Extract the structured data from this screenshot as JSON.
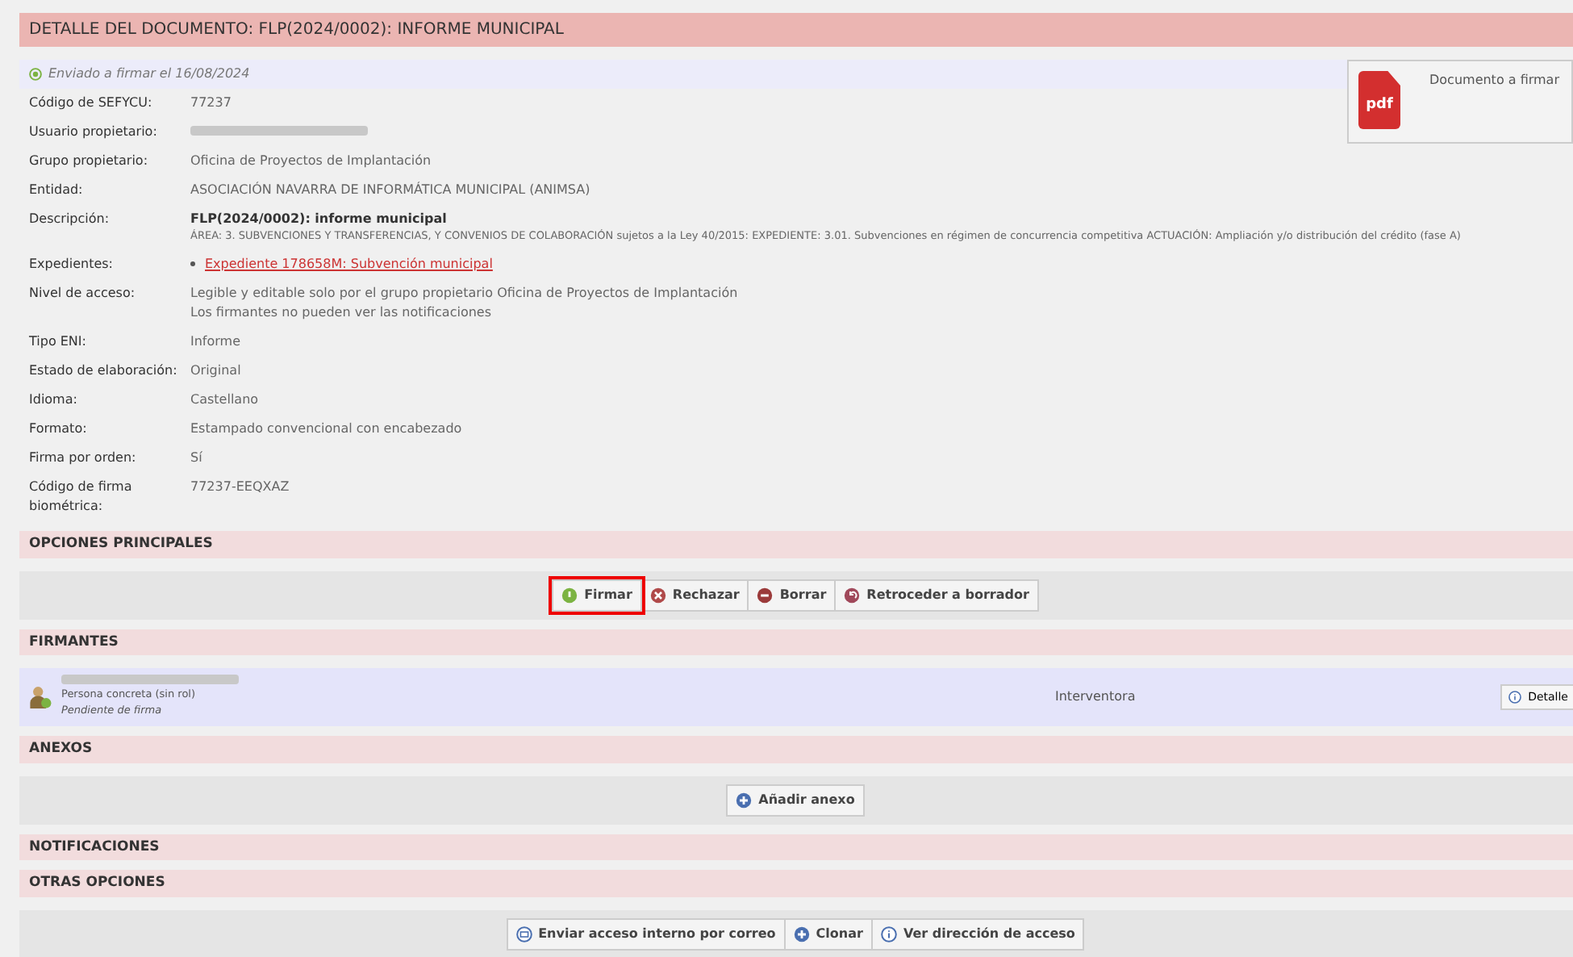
{
  "title": "DETALLE DEL DOCUMENTO: FLP(2024/0002): INFORME MUNICIPAL",
  "status": "Enviado a firmar el 16/08/2024",
  "document_card": {
    "label": "Documento a firmar",
    "file_type": "pdf"
  },
  "fields": [
    {
      "kind": "text",
      "label": "Código de SEFYCU:",
      "lines": [
        "77237"
      ]
    },
    {
      "kind": "redacted",
      "label": "Usuario propietario:"
    },
    {
      "kind": "text",
      "label": "Grupo propietario:",
      "lines": [
        "Oficina de Proyectos de Implantación"
      ]
    },
    {
      "kind": "text",
      "label": "Entidad:",
      "lines": [
        "ASOCIACIÓN NAVARRA DE INFORMÁTICA MUNICIPAL (ANIMSA)"
      ]
    },
    {
      "kind": "description",
      "label": "Descripción:",
      "lines": [
        "FLP(2024/0002): informe municipal",
        "ÁREA: 3. SUBVENCIONES Y TRANSFERENCIAS, Y CONVENIOS DE COLABORACIÓN sujetos a la Ley 40/2015: EXPEDIENTE: 3.01. Subvenciones en régimen de concurrencia competitiva ACTUACIÓN: Ampliación y/o distribución del crédito (fase A)"
      ]
    },
    {
      "kind": "link",
      "label": "Expedientes:",
      "lines": [
        "Expediente 178658M: Subvención municipal"
      ]
    },
    {
      "kind": "text",
      "label": "Nivel de acceso:",
      "lines": [
        "Legible y editable solo por el grupo propietario Oficina de Proyectos de Implantación",
        "Los firmantes no pueden ver las notificaciones"
      ]
    },
    {
      "kind": "text",
      "label": "Tipo ENI:",
      "lines": [
        "Informe"
      ]
    },
    {
      "kind": "text",
      "label": "Estado de elaboración:",
      "lines": [
        "Original"
      ]
    },
    {
      "kind": "text",
      "label": "Idioma:",
      "lines": [
        "Castellano"
      ]
    },
    {
      "kind": "text",
      "label": "Formato:",
      "lines": [
        "Estampado convencional con encabezado"
      ]
    },
    {
      "kind": "text",
      "label": "Firma por orden:",
      "lines": [
        "Sí"
      ]
    },
    {
      "kind": "text",
      "label": "Código de firma biométrica:",
      "lines": [
        "77237-EEQXAZ"
      ]
    }
  ],
  "sections": [
    {
      "title": "OPCIONES PRINCIPALES",
      "kind": "buttons",
      "buttons": [
        {
          "label": "Firmar",
          "kind": "sign",
          "highlighted": true
        },
        {
          "label": "Rechazar",
          "kind": "reject",
          "highlighted": false
        },
        {
          "label": "Borrar",
          "kind": "delete",
          "highlighted": false
        },
        {
          "label": "Retroceder a borrador",
          "kind": "back",
          "highlighted": false
        }
      ]
    },
    {
      "title": "FIRMANTES",
      "kind": "signers",
      "signers": [
        {
          "role": "Persona concreta (sin rol)",
          "state": "Pendiente de firma",
          "position": "Interventora",
          "button": "Detalle"
        }
      ]
    },
    {
      "title": "ANEXOS",
      "kind": "buttons",
      "buttons": [
        {
          "label": "Añadir anexo",
          "kind": "add",
          "highlighted": false
        }
      ]
    },
    {
      "title": "NOTIFICACIONES",
      "kind": "empty"
    },
    {
      "title": "OTRAS OPCIONES",
      "kind": "buttons",
      "buttons": [
        {
          "label": "Enviar acceso interno por correo",
          "kind": "mail",
          "highlighted": false
        },
        {
          "label": "Clonar",
          "kind": "add",
          "highlighted": false
        },
        {
          "label": "Ver dirección de acceso",
          "kind": "info",
          "highlighted": false
        }
      ]
    }
  ]
}
